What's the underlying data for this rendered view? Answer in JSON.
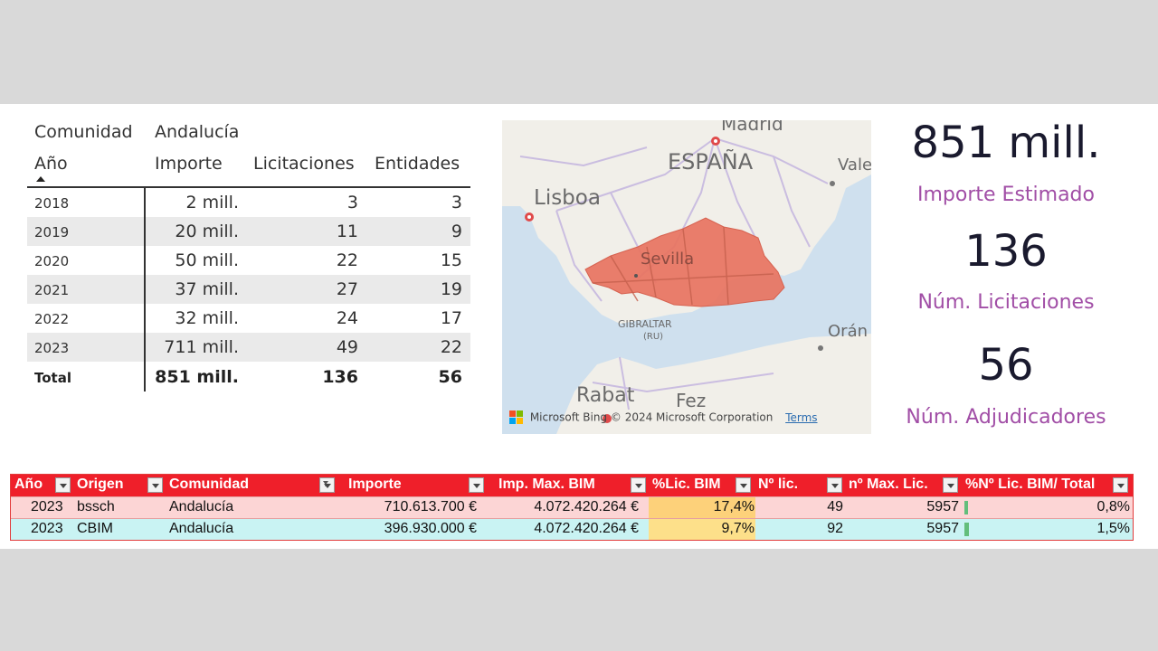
{
  "matrix": {
    "header": {
      "filter_field": "Comunidad",
      "filter_value": "Andalucía",
      "col_year": "Año",
      "col_importe": "Importe",
      "col_licitaciones": "Licitaciones",
      "col_entidades": "Entidades"
    },
    "rows": [
      {
        "year": "2018",
        "importe": "2 mill.",
        "licitaciones": "3",
        "entidades": "3"
      },
      {
        "year": "2019",
        "importe": "20 mill.",
        "licitaciones": "11",
        "entidades": "9"
      },
      {
        "year": "2020",
        "importe": "50 mill.",
        "licitaciones": "22",
        "entidades": "15"
      },
      {
        "year": "2021",
        "importe": "37 mill.",
        "licitaciones": "27",
        "entidades": "19"
      },
      {
        "year": "2022",
        "importe": "32 mill.",
        "licitaciones": "24",
        "entidades": "17"
      },
      {
        "year": "2023",
        "importe": "711 mill.",
        "licitaciones": "49",
        "entidades": "22"
      }
    ],
    "total": {
      "label": "Total",
      "importe": "851 mill.",
      "licitaciones": "136",
      "entidades": "56"
    }
  },
  "map": {
    "labels": {
      "madrid": "Madrid",
      "espana": "ESPAÑA",
      "valencia": "Vale",
      "lisboa": "Lisboa",
      "sevilla": "Sevilla",
      "gibraltar": "GIBRALTAR",
      "gibraltar_sub": "(RU)",
      "oran": "Orán",
      "rabat": "Rabat",
      "fez": "Fez"
    },
    "credit": "Microsoft Bing",
    "copyright": "© 2024 Microsoft Corporation",
    "terms": "Terms",
    "highlight_color": "#e8735f"
  },
  "kpis": [
    {
      "value": "851 mill.",
      "label": "Importe Estimado"
    },
    {
      "value": "136",
      "label": "Núm. Licitaciones"
    },
    {
      "value": "56",
      "label": "Núm. Adjudicadores"
    }
  ],
  "excel": {
    "headers": [
      "Año",
      "Origen",
      "Comunidad",
      "Importe",
      "Imp. Max. BIM",
      "%Lic. BIM",
      "Nº lic.",
      "nº Max. Lic.",
      "%Nº Lic. BIM/ Total"
    ],
    "rows": [
      {
        "ano": "2023",
        "origen": "bssch",
        "comunidad": "Andalucía",
        "importe": "710.613.700 €",
        "imp_max": "4.072.420.264 €",
        "pct_lic": "17,4%",
        "n_lic": "49",
        "n_max": "5957",
        "pct_total": "0,8%"
      },
      {
        "ano": "2023",
        "origen": "CBIM",
        "comunidad": "Andalucía",
        "importe": "396.930.000 €",
        "imp_max": "4.072.420.264 €",
        "pct_lic": "9,7%",
        "n_lic": "92",
        "n_max": "5957",
        "pct_total": "1,5%"
      }
    ],
    "colors": {
      "header": "#ef1f2a",
      "row1": "#fcd5d5",
      "row2": "#c9f3f3",
      "pct_high": "#fdd17a",
      "pct_low": "#fde08a"
    }
  }
}
